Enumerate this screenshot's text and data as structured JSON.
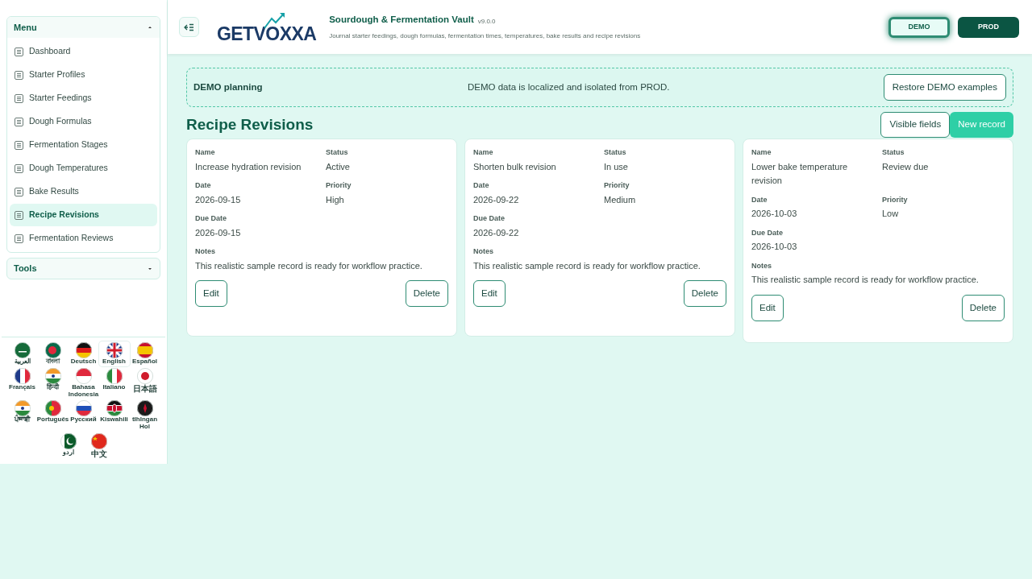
{
  "sidebar": {
    "menu": {
      "title": "Menu",
      "expanded": true,
      "items": [
        {
          "label": "Dashboard",
          "selected": false
        },
        {
          "label": "Starter Profiles",
          "selected": false
        },
        {
          "label": "Starter Feedings",
          "selected": false
        },
        {
          "label": "Dough Formulas",
          "selected": false
        },
        {
          "label": "Fermentation Stages",
          "selected": false
        },
        {
          "label": "Dough Temperatures",
          "selected": false
        },
        {
          "label": "Bake Results",
          "selected": false
        },
        {
          "label": "Recipe Revisions",
          "selected": true
        },
        {
          "label": "Fermentation Reviews",
          "selected": false
        }
      ]
    },
    "tools": {
      "title": "Tools",
      "expanded": false
    },
    "languages": [
      {
        "label": "العربية",
        "selected": false
      },
      {
        "label": "বাংলা",
        "selected": false
      },
      {
        "label": "Deutsch",
        "selected": false
      },
      {
        "label": "English",
        "selected": true
      },
      {
        "label": "Español",
        "selected": false
      },
      {
        "label": "Français",
        "selected": false
      },
      {
        "label": "हिन्दी",
        "selected": false
      },
      {
        "label": "Bahasa Indonesia",
        "selected": false
      },
      {
        "label": "Italiano",
        "selected": false
      },
      {
        "label": "日本語",
        "selected": false
      },
      {
        "label": "ਪੰਜਾਬੀ",
        "selected": false
      },
      {
        "label": "Português",
        "selected": false
      },
      {
        "label": "Русский",
        "selected": false
      },
      {
        "label": "Kiswahili",
        "selected": false
      },
      {
        "label": "tlhIngan Hol",
        "selected": false
      },
      {
        "label": "اردو",
        "selected": false
      },
      {
        "label": "中文",
        "selected": false
      }
    ]
  },
  "header": {
    "logo": "GETVOXXA",
    "title": "Sourdough & Fermentation Vault",
    "version": "v9.0.0",
    "subtitle": "Journal starter feedings, dough formulas, fermentation times, temperatures, bake results and recipe revisions",
    "environments": [
      {
        "label": "DEMO",
        "selected": true
      },
      {
        "label": "PROD",
        "selected": false
      }
    ]
  },
  "banner": {
    "title": "DEMO planning",
    "message": "DEMO data is localized and isolated from PROD.",
    "button": "Restore DEMO examples"
  },
  "section": {
    "title": "Recipe Revisions",
    "buttons": [
      {
        "label": "Visible fields",
        "kind": "outline"
      },
      {
        "label": "New record",
        "kind": "primary"
      }
    ]
  },
  "records": [
    {
      "fields": [
        {
          "label": "Name",
          "value": "Increase hydration revision"
        },
        {
          "label": "Status",
          "value": "Active"
        },
        {
          "label": "Date",
          "value": "2026-09-15"
        },
        {
          "label": "Priority",
          "value": "High"
        },
        {
          "label": "Due Date",
          "value": "2026-09-15"
        }
      ],
      "notes_label": "Notes",
      "notes": "This realistic sample record is ready for workflow practice.",
      "actions": [
        "Edit",
        "Delete"
      ]
    },
    {
      "fields": [
        {
          "label": "Name",
          "value": "Shorten bulk revision"
        },
        {
          "label": "Status",
          "value": "In use"
        },
        {
          "label": "Date",
          "value": "2026-09-22"
        },
        {
          "label": "Priority",
          "value": "Medium"
        },
        {
          "label": "Due Date",
          "value": "2026-09-22"
        }
      ],
      "notes_label": "Notes",
      "notes": "This realistic sample record is ready for workflow practice.",
      "actions": [
        "Edit",
        "Delete"
      ]
    },
    {
      "fields": [
        {
          "label": "Name",
          "value": "Lower bake temperature revision"
        },
        {
          "label": "Status",
          "value": "Review due"
        },
        {
          "label": "Date",
          "value": "2026-10-03"
        },
        {
          "label": "Priority",
          "value": "Low"
        },
        {
          "label": "Due Date",
          "value": "2026-10-03"
        }
      ],
      "notes_label": "Notes",
      "notes": "This realistic sample record is ready for workflow practice.",
      "actions": [
        "Edit",
        "Delete"
      ]
    }
  ]
}
